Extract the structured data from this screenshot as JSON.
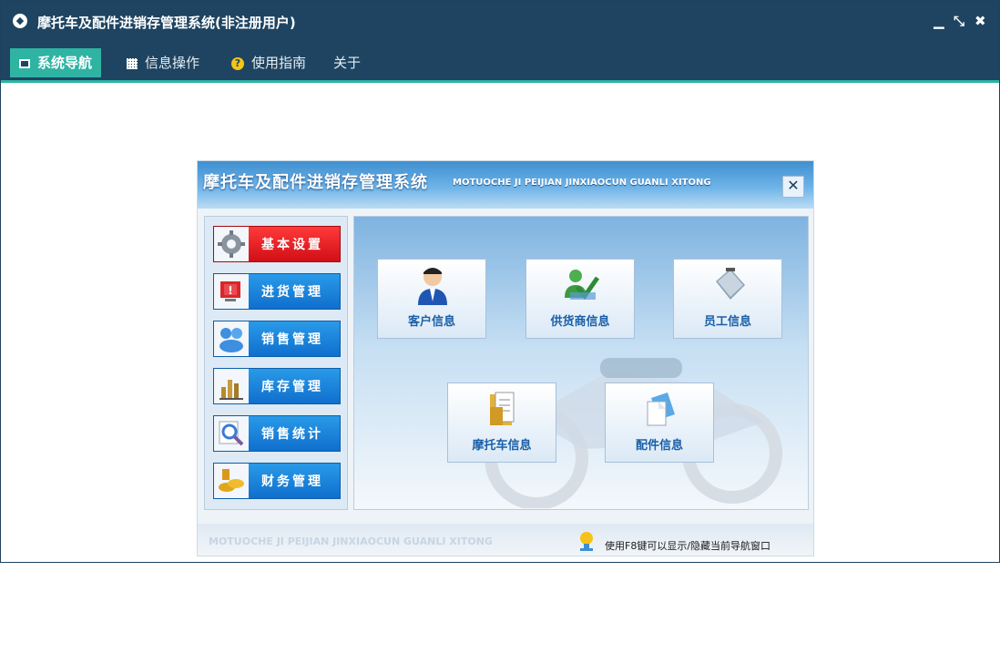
{
  "window": {
    "title": "摩托车及配件进销存管理系统(非注册用户)",
    "controls": {
      "minimize": "▁",
      "restore": "⤡",
      "close": "✖"
    }
  },
  "menubar": {
    "items": [
      {
        "label": "系统导航",
        "icon": "screen-icon",
        "active": true
      },
      {
        "label": "信息操作",
        "icon": "grid-icon",
        "active": false
      },
      {
        "label": "使用指南",
        "icon": "help-icon",
        "active": false
      },
      {
        "label": "关于",
        "icon": "",
        "active": false
      }
    ]
  },
  "nav": {
    "title": "摩托车及配件进销存管理系统",
    "subtitle": "MOTUOCHE JI PEIJIAN JINXIAOCUN GUANLI XITONG",
    "close": "✕",
    "side_buttons": [
      {
        "label": "基本设置",
        "icon": "gear-icon",
        "active": true
      },
      {
        "label": "进货管理",
        "icon": "monitor-alert-icon",
        "active": false
      },
      {
        "label": "销售管理",
        "icon": "users-icon",
        "active": false
      },
      {
        "label": "库存管理",
        "icon": "stock-chart-icon",
        "active": false
      },
      {
        "label": "销售统计",
        "icon": "magnifier-icon",
        "active": false
      },
      {
        "label": "财务管理",
        "icon": "coins-icon",
        "active": false
      }
    ],
    "tiles": [
      {
        "label": "客户信息",
        "icon": "customer-icon"
      },
      {
        "label": "供货商信息",
        "icon": "supplier-icon"
      },
      {
        "label": "员工信息",
        "icon": "employee-icon"
      },
      {
        "label": "摩托车信息",
        "icon": "folder-icon"
      },
      {
        "label": "配件信息",
        "icon": "documents-icon"
      }
    ],
    "footer": {
      "watermark": "MOTUOCHE JI PEIJIAN JINXIAOCUN GUANLI XITONG",
      "tip": "使用F8键可以显示/隐藏当前导航窗口"
    }
  },
  "colors": {
    "titlebar": "#1e4461",
    "active_tab": "#2fb3a3",
    "side_button": "#1780d8",
    "side_button_active": "#e51b22",
    "tile_label": "#1a5fa8"
  }
}
